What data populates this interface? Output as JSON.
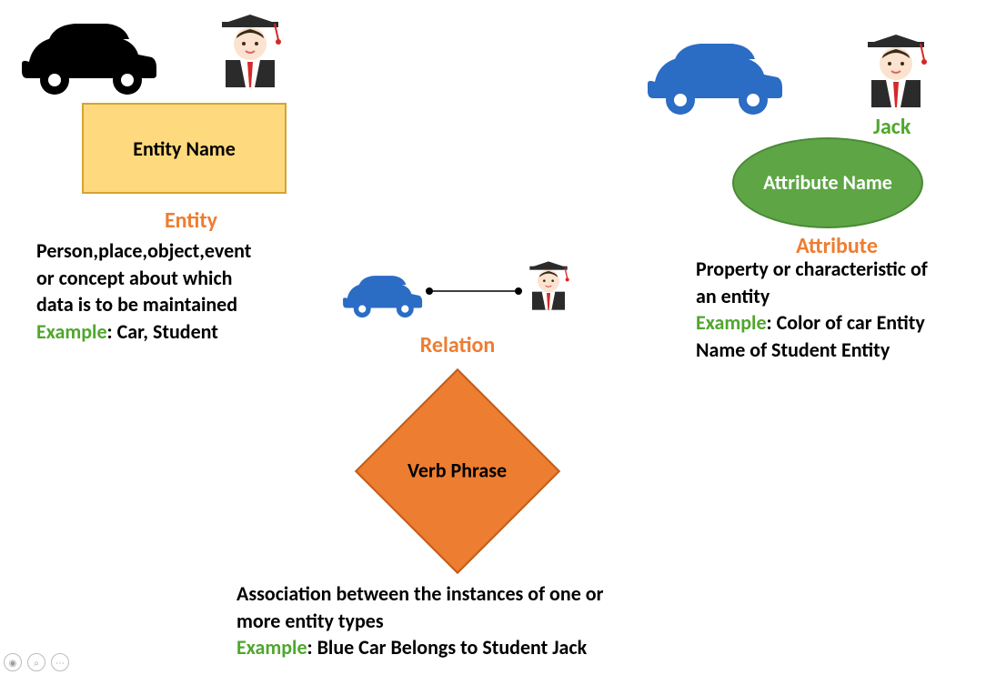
{
  "entity": {
    "box_label": "Entity Name",
    "heading": "Entity",
    "desc_line1": "Person,place,object,event",
    "desc_line2": "or concept about which",
    "desc_line3": "data is to be maintained",
    "example_prefix": "Example",
    "example_text": ": Car, Student"
  },
  "attribute": {
    "ellipse_label": "Attribute Name",
    "heading": "Attribute",
    "jack_label": "Jack",
    "desc_line1": "Property or characteristic of",
    "desc_line2": "an entity",
    "example_prefix": "Example",
    "example_text1": ": Color of car Entity",
    "example_text2": "Name of Student Entity"
  },
  "relation": {
    "diamond_label": "Verb Phrase",
    "heading": "Relation",
    "desc_line1": "Association between the instances of one or",
    "desc_line2": "more entity types",
    "example_prefix": "Example",
    "example_text": ": Blue Car Belongs to Student Jack"
  },
  "controls": {
    "b1": "◉",
    "b2": "⌕",
    "b3": "⋯"
  }
}
